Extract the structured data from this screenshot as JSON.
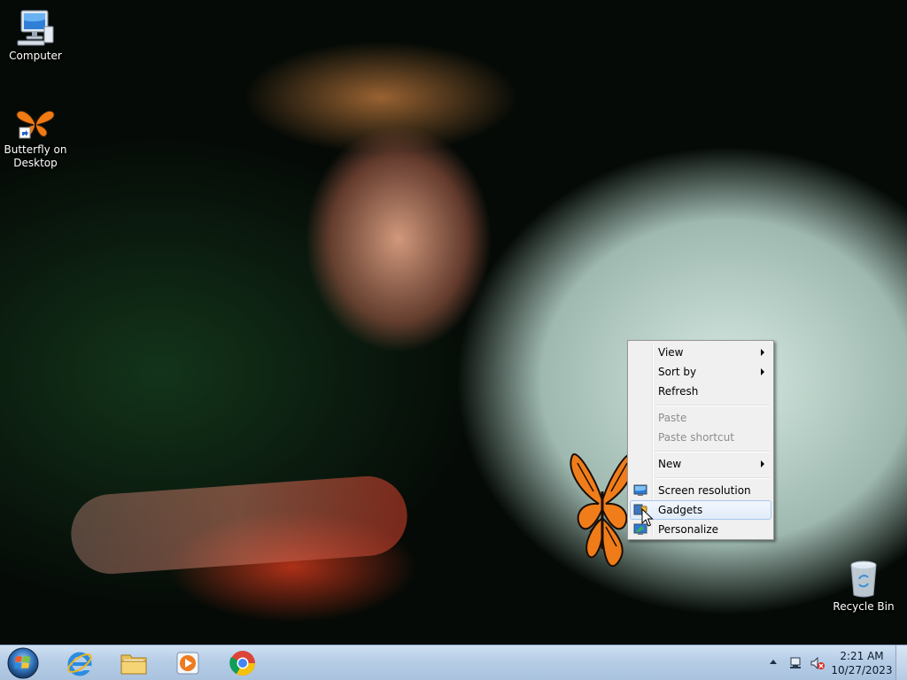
{
  "desktop": {
    "icons": [
      {
        "label": "Computer",
        "icon": "computer-icon"
      },
      {
        "label": "Butterfly on Desktop",
        "icon": "butterfly-shortcut-icon"
      },
      {
        "label": "Recycle Bin",
        "icon": "recycle-bin-icon"
      }
    ]
  },
  "context_menu": {
    "items": [
      {
        "label": "View",
        "submenu": true,
        "enabled": true
      },
      {
        "label": "Sort by",
        "submenu": true,
        "enabled": true
      },
      {
        "label": "Refresh",
        "submenu": false,
        "enabled": true
      },
      {
        "label": "Paste",
        "submenu": false,
        "enabled": false
      },
      {
        "label": "Paste shortcut",
        "submenu": false,
        "enabled": false
      },
      {
        "label": "New",
        "submenu": true,
        "enabled": true
      },
      {
        "label": "Screen resolution",
        "icon": "screen-resolution-icon",
        "enabled": true
      },
      {
        "label": "Gadgets",
        "icon": "gadgets-icon",
        "enabled": true,
        "highlighted": true
      },
      {
        "label": "Personalize",
        "icon": "personalize-icon",
        "enabled": true
      }
    ]
  },
  "taskbar": {
    "pinned": [
      {
        "name": "Internet Explorer",
        "icon": "internet-explorer-icon"
      },
      {
        "name": "Windows Explorer",
        "icon": "folder-icon"
      },
      {
        "name": "Windows Media Player",
        "icon": "media-player-icon"
      },
      {
        "name": "Google Chrome",
        "icon": "chrome-icon"
      }
    ],
    "clock": {
      "time": "2:21 AM",
      "date": "10/27/2023"
    }
  },
  "colors": {
    "menu_background": "#f0f0f0",
    "menu_highlight_border": "#a8c8ec",
    "taskbar": "#b6cde6"
  }
}
